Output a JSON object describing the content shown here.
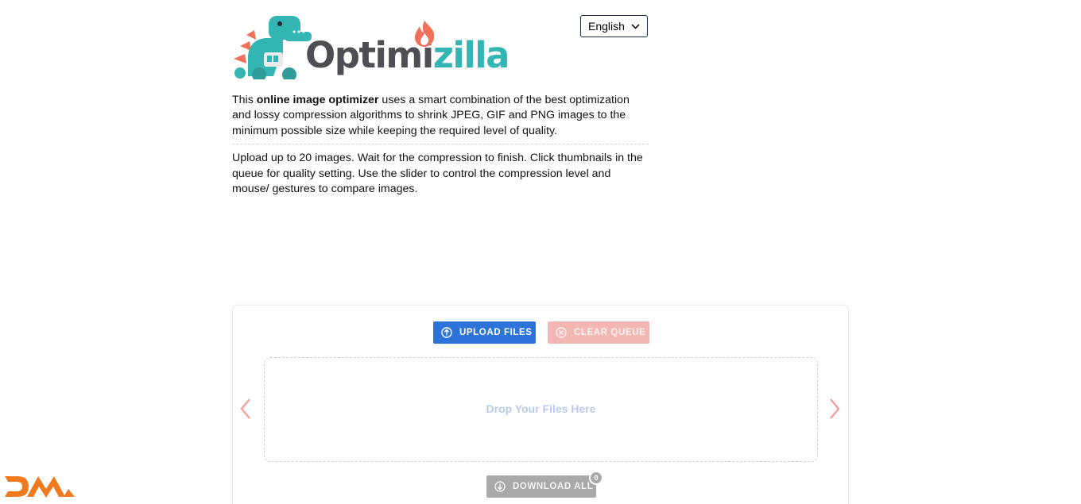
{
  "brand": {
    "name_part1": "Optimi",
    "name_part2": "zilla",
    "accent_color": "#33b5b3",
    "text_color": "#4d4f54",
    "flame_color": "#f0705a"
  },
  "language": {
    "selected": "English",
    "icon": "chevron-down-icon"
  },
  "intro": {
    "p1_before": "This ",
    "p1_bold": "online image optimizer",
    "p1_after": " uses a smart combination of the best optimization and lossy compression algorithms to shrink JPEG, GIF and PNG images to the minimum possible size while keeping the required level of quality.",
    "p2": "Upload up to 20 images. Wait for the compression to finish. Click thumbnails in the queue for quality setting. Use the slider to control the compression level and mouse/ gestures to compare images."
  },
  "uploader": {
    "upload_label": "Upload Files",
    "clear_label": "Clear Queue",
    "drop_text": "Drop Your Files Here",
    "download_label": "Download All",
    "download_count": "0",
    "colors": {
      "upload": "#2d73d9",
      "clear": "#f2b7b2",
      "arrows": "#f0a39b",
      "download": "#a7a9ab"
    }
  },
  "watermark": {
    "color": "#f07a1e"
  }
}
